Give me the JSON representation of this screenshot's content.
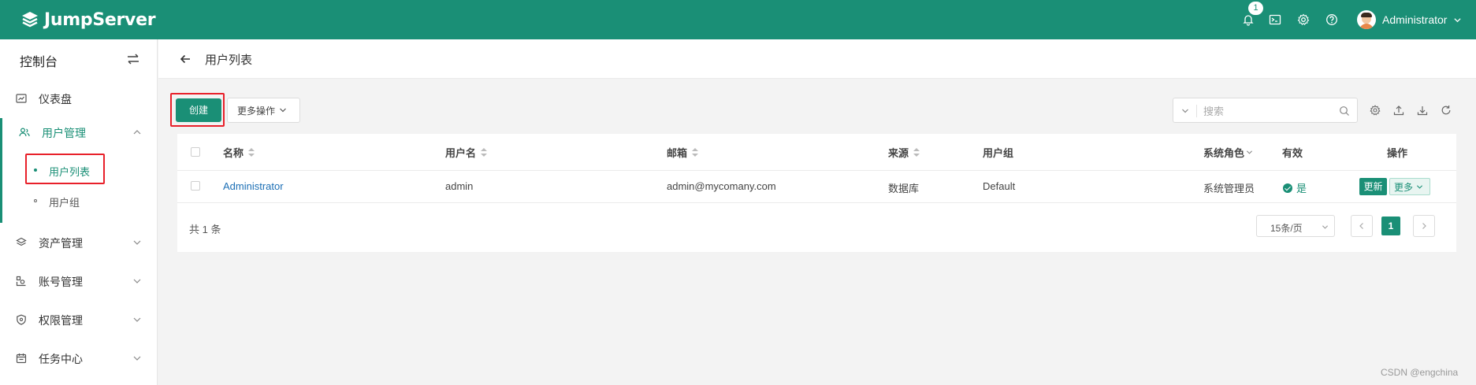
{
  "brand": {
    "name": "JumpServer",
    "color": "#1a8f76"
  },
  "header": {
    "notifications": {
      "icon": "bell-icon",
      "count": "1"
    },
    "icons": [
      "terminal-icon",
      "gear-icon",
      "help-icon"
    ],
    "user": {
      "name": "Administrator"
    }
  },
  "sidebar": {
    "title": "控制台",
    "items": [
      {
        "label": "仪表盘",
        "icon": "dashboard-icon"
      },
      {
        "label": "用户管理",
        "icon": "users-icon",
        "expanded": true,
        "children": [
          {
            "label": "用户列表",
            "active": true
          },
          {
            "label": "用户组"
          }
        ]
      },
      {
        "label": "资产管理",
        "icon": "layers-icon"
      },
      {
        "label": "账号管理",
        "icon": "accounts-icon"
      },
      {
        "label": "权限管理",
        "icon": "shield-icon"
      },
      {
        "label": "任务中心",
        "icon": "calendar-icon"
      }
    ]
  },
  "page": {
    "title": "用户列表"
  },
  "toolbar": {
    "create_label": "创建",
    "more_label": "更多操作",
    "search_placeholder": "搜索"
  },
  "table": {
    "headers": {
      "name": "名称",
      "username": "用户名",
      "email": "邮箱",
      "source": "来源",
      "groups": "用户组",
      "role": "系统角色",
      "valid": "有效",
      "actions": "操作"
    },
    "rows": [
      {
        "name": "Administrator",
        "username": "admin",
        "email": "admin@mycomany.com",
        "source": "数据库",
        "groups": "Default",
        "role": "系统管理员",
        "valid": "是",
        "update_label": "更新",
        "more_label": "更多"
      }
    ]
  },
  "pagination": {
    "total": "共 1 条",
    "page_size": "15条/页",
    "current": "1"
  },
  "watermark": "CSDN @engchina"
}
